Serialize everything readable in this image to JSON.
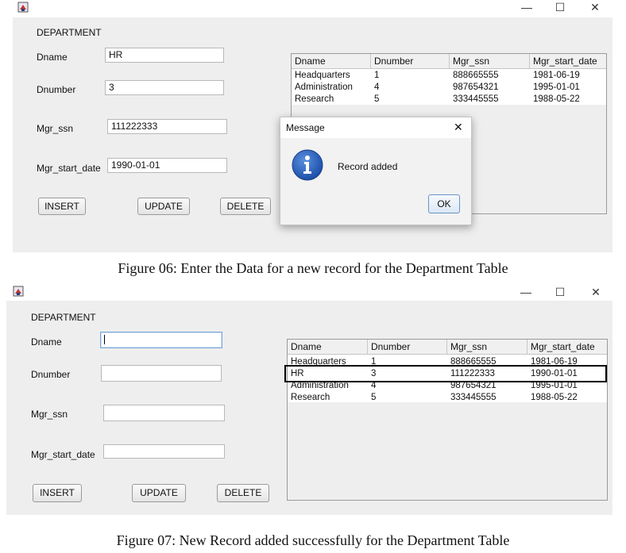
{
  "window_controls": {
    "minimize": "—",
    "maximize": "☐",
    "close": "✕"
  },
  "top": {
    "section_label": "DEPARTMENT",
    "fields": [
      {
        "label": "Dname",
        "value": "HR"
      },
      {
        "label": "Dnumber",
        "value": "3"
      },
      {
        "label": "Mgr_ssn",
        "value": "111222333"
      },
      {
        "label": "Mgr_start_date",
        "value": "1990-01-01"
      }
    ],
    "buttons": {
      "insert": "INSERT",
      "update": "UPDATE",
      "delete": "DELETE"
    },
    "table": {
      "columns": [
        "Dname",
        "Dnumber",
        "Mgr_ssn",
        "Mgr_start_date"
      ],
      "rows": [
        [
          "Headquarters",
          "1",
          "888665555",
          "1981-06-19"
        ],
        [
          "Administration",
          "4",
          "987654321",
          "1995-01-01"
        ],
        [
          "Research",
          "5",
          "333445555",
          "1988-05-22"
        ]
      ]
    },
    "dialog": {
      "title": "Message",
      "message": "Record added",
      "ok": "OK",
      "close": "✕"
    }
  },
  "caption_top": "Figure 06: Enter the Data for a new record for the Department Table",
  "bottom": {
    "section_label": "DEPARTMENT",
    "fields": [
      {
        "label": "Dname",
        "value": ""
      },
      {
        "label": "Dnumber",
        "value": ""
      },
      {
        "label": "Mgr_ssn",
        "value": ""
      },
      {
        "label": "Mgr_start_date",
        "value": ""
      }
    ],
    "buttons": {
      "insert": "INSERT",
      "update": "UPDATE",
      "delete": "DELETE"
    },
    "table": {
      "columns": [
        "Dname",
        "Dnumber",
        "Mgr_ssn",
        "Mgr_start_date"
      ],
      "rows": [
        [
          "Headquarters",
          "1",
          "888665555",
          "1981-06-19"
        ],
        [
          "HR",
          "3",
          "111222333",
          "1990-01-01"
        ],
        [
          "Administration",
          "4",
          "987654321",
          "1995-01-01"
        ],
        [
          "Research",
          "5",
          "333445555",
          "1988-05-22"
        ]
      ]
    }
  },
  "caption_bottom": "Figure 07: New Record added successfully for the Department Table"
}
